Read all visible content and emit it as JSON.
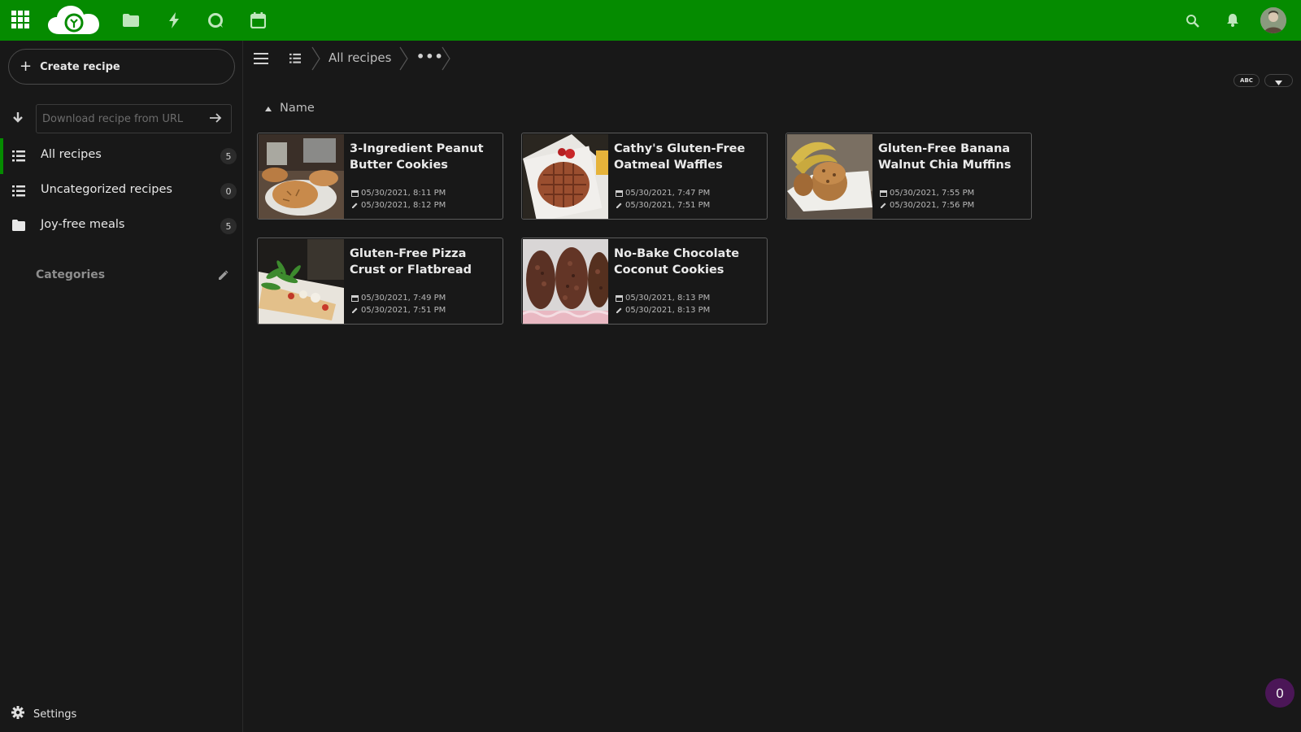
{
  "header": {
    "icons": [
      "apps-grid-icon",
      "nextcloud-cookbook-logo",
      "files-icon",
      "activity-icon",
      "talk-icon",
      "calendar-icon",
      "search-icon",
      "notifications-icon",
      "user-avatar"
    ],
    "bg_color": "#058b00"
  },
  "sidebar": {
    "create_label": "Create recipe",
    "download_placeholder": "Download recipe from URL",
    "items": [
      {
        "label": "All recipes",
        "count": "5",
        "icon": "list-icon",
        "active": true
      },
      {
        "label": "Uncategorized recipes",
        "count": "0",
        "icon": "list-icon",
        "active": false
      },
      {
        "label": "Joy-free meals",
        "count": "5",
        "icon": "folder-icon",
        "active": false
      }
    ],
    "categories_label": "Categories",
    "settings_label": "Settings"
  },
  "breadcrumb": {
    "current": "All recipes",
    "more": "•••"
  },
  "sort": {
    "abc_label": "ABC",
    "field_label": "Name"
  },
  "recipes": [
    {
      "title": "3-Ingredient Peanut Butter Cookies",
      "created": "05/30/2021, 8:11 PM",
      "modified": "05/30/2021, 8:12 PM"
    },
    {
      "title": "Cathy's Gluten-Free Oatmeal Waffles",
      "created": "05/30/2021, 7:47 PM",
      "modified": "05/30/2021, 7:51 PM"
    },
    {
      "title": "Gluten-Free Banana Walnut Chia Muffins",
      "created": "05/30/2021, 7:55 PM",
      "modified": "05/30/2021, 7:56 PM"
    },
    {
      "title": "Gluten-Free Pizza Crust or Flatbread",
      "created": "05/30/2021, 7:49 PM",
      "modified": "05/30/2021, 7:51 PM"
    },
    {
      "title": "No-Bake Chocolate Coconut Cookies",
      "created": "05/30/2021, 8:13 PM",
      "modified": "05/30/2021, 8:13 PM"
    }
  ],
  "badge_count": "0"
}
